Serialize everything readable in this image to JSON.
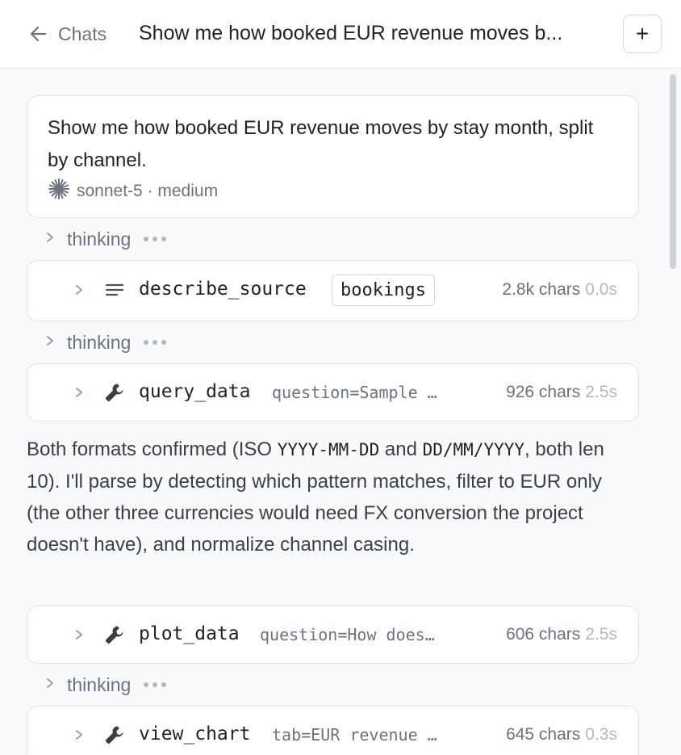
{
  "header": {
    "back_label": "Chats",
    "title": "Show me how booked EUR revenue moves b...",
    "new_label": "+"
  },
  "user_message": {
    "text": "Show me how booked EUR revenue moves by stay month, split by channel.",
    "model": "sonnet-5 · medium"
  },
  "thinking_label": "thinking",
  "tools": [
    {
      "name": "describe_source",
      "tag": "bookings",
      "chars": "2.8k chars",
      "time": "0.0s",
      "icon": "list-icon"
    },
    {
      "name": "query_data",
      "args": "question=Sample …",
      "chars": "926 chars",
      "time": "2.5s",
      "icon": "wrench-icon"
    },
    {
      "name": "plot_data",
      "args": "question=How does…",
      "chars": "606 chars",
      "time": "2.5s",
      "icon": "wrench-icon"
    },
    {
      "name": "view_chart",
      "args": "tab=EUR revenue …",
      "chars": "645 chars",
      "time": "0.3s",
      "icon": "wrench-icon"
    }
  ],
  "assistant_text": {
    "p1": "Both formats confirmed (ISO ",
    "code1": "YYYY-MM-DD",
    "p2": " and ",
    "code2": "DD/MM/YYYY",
    "p3": ", both len 10). I'll parse by detecting which pattern matches, filter to EUR only (the other three currencies would need FX conversion the project doesn't have), and normalize channel casing."
  }
}
